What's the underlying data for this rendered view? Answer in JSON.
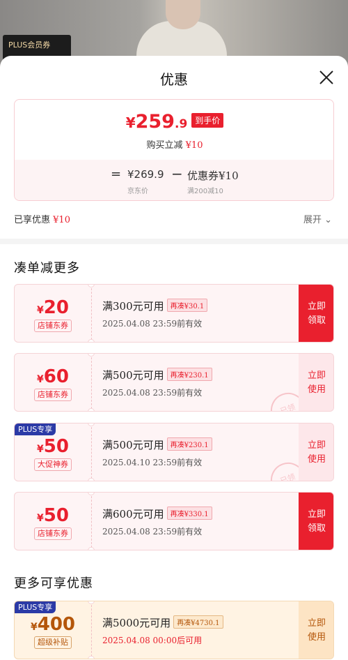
{
  "background": {
    "plus_tag": "PLUS会员券"
  },
  "sheet": {
    "title": "优惠"
  },
  "price": {
    "currency": "¥",
    "integer": "259",
    "decimal": ".9",
    "tag": "到手价",
    "sub_prefix": "购买立减",
    "sub_amount": "¥10",
    "equals": "=",
    "original": "¥269.9",
    "original_label": "京东价",
    "minus": "−",
    "coupon": "优惠券¥10",
    "coupon_label": "满200减10"
  },
  "enjoyed": {
    "prefix": "已享优惠",
    "amount": "¥10",
    "expand": "展开 ⌄"
  },
  "sections": {
    "more_discount": "凑单减更多",
    "more_offers": "更多可享优惠"
  },
  "coupons": [
    {
      "currency": "¥",
      "amount": "20",
      "type": "店铺东券",
      "condition": "满300元可用",
      "pill": "再凑¥30.1",
      "valid": "2025.04.08 23:59前有效",
      "button": "立即\n领取"
    },
    {
      "currency": "¥",
      "amount": "60",
      "type": "店铺东券",
      "condition": "满500元可用",
      "pill": "再凑¥230.1",
      "valid": "2025.04.08 23:59前有效",
      "button": "立即\n使用",
      "stamp": "已领"
    },
    {
      "badge": "PLUS专享",
      "currency": "¥",
      "amount": "50",
      "type": "大促神券",
      "condition": "满500元可用",
      "pill": "再凑¥230.1",
      "valid": "2025.04.10 23:59前有效",
      "button": "立即\n使用",
      "stamp": "已领"
    },
    {
      "currency": "¥",
      "amount": "50",
      "type": "店铺东券",
      "condition": "满600元可用",
      "pill": "再凑¥330.1",
      "valid": "2025.04.08 23:59前有效",
      "button": "立即\n领取"
    },
    {
      "badge": "PLUS专享",
      "currency": "¥",
      "amount": "400",
      "type": "超级补贴",
      "condition": "满5000元可用",
      "pill": "再凑¥4730.1",
      "valid": "2025.04.08 00:00后可用",
      "button": "立即\n使用"
    }
  ],
  "colors": {
    "accent": "#e9202e",
    "gold": "#b4560a",
    "plus": "#2b3aa6"
  }
}
